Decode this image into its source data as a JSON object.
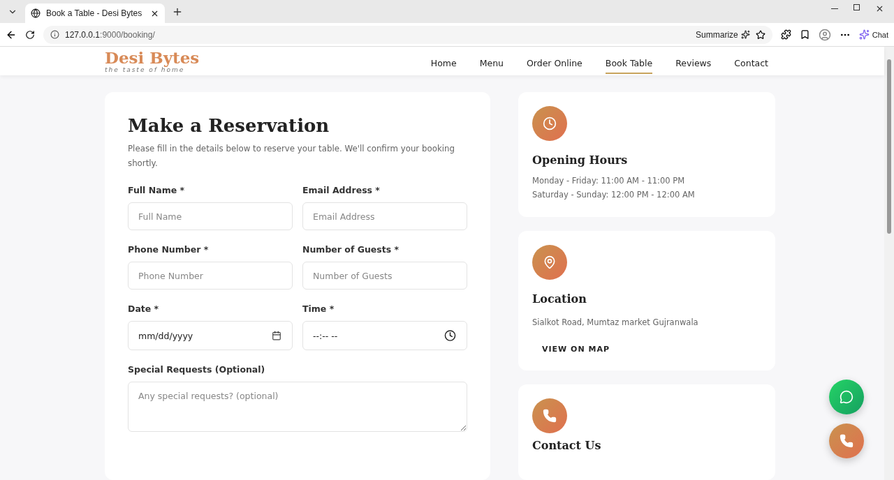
{
  "browser": {
    "tab_title": "Book a Table - Desi Bytes",
    "url_host": "127.0.0.1",
    "url_rest": ":9000/booking/",
    "summarize": "Summarize",
    "chat": "Chat"
  },
  "nav": {
    "brand": "Desi Bytes",
    "tagline": "the taste of home",
    "links": [
      {
        "label": "Home",
        "selected": false
      },
      {
        "label": "Menu",
        "selected": false
      },
      {
        "label": "Order Online",
        "selected": false
      },
      {
        "label": "Book Table",
        "selected": true
      },
      {
        "label": "Reviews",
        "selected": false
      },
      {
        "label": "Contact",
        "selected": false
      }
    ]
  },
  "form": {
    "title": "Make a Reservation",
    "intro": "Please fill in the details below to reserve your table. We'll confirm your booking shortly.",
    "fields": [
      {
        "kind": "text",
        "label": "Full Name *",
        "placeholder": "Full Name"
      },
      {
        "kind": "text",
        "label": "Email Address *",
        "placeholder": "Email Address"
      },
      {
        "kind": "text",
        "label": "Phone Number *",
        "placeholder": "Phone Number"
      },
      {
        "kind": "text",
        "label": "Number of Guests *",
        "placeholder": "Number of Guests"
      },
      {
        "kind": "date",
        "label": "Date *",
        "value": "mm/dd/yyyy"
      },
      {
        "kind": "time",
        "label": "Time *",
        "value": "--:-- --"
      },
      {
        "kind": "textarea",
        "label": "Special Requests (Optional)",
        "placeholder": "Any special requests? (optional)"
      }
    ]
  },
  "info_cards": [
    {
      "kind": "hours",
      "title": "Opening Hours",
      "lines": [
        "Monday - Friday: 11:00 AM - 11:00 PM",
        "Saturday - Sunday: 12:00 PM - 12:00 AM"
      ]
    },
    {
      "kind": "location",
      "title": "Location",
      "lines": [
        "Sialkot Road, Mumtaz market Gujranwala"
      ],
      "link": "VIEW ON MAP"
    },
    {
      "kind": "contact",
      "title": "Contact Us"
    }
  ],
  "floating_buttons": [
    {
      "kind": "whatsapp"
    },
    {
      "kind": "phone"
    }
  ]
}
